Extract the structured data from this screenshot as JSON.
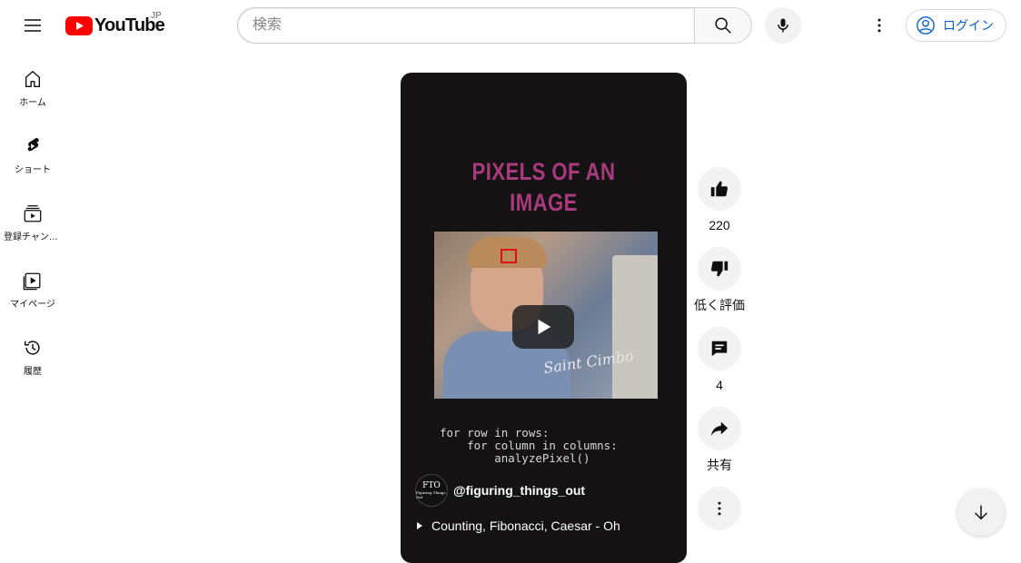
{
  "header": {
    "logo_text": "YouTube",
    "region": "JP",
    "search_placeholder": "検索",
    "login_label": "ログイン"
  },
  "sidebar": {
    "items": [
      {
        "label": "ホーム",
        "icon": "home-icon"
      },
      {
        "label": "ショート",
        "icon": "shorts-icon"
      },
      {
        "label": "登録チャンネル",
        "icon": "subscriptions-icon"
      },
      {
        "label": "マイページ",
        "icon": "library-icon"
      },
      {
        "label": "履歴",
        "icon": "history-icon"
      }
    ]
  },
  "short": {
    "frame_title": "PIXELS OF AN\nIMAGE",
    "code": "for row in rows:\n    for column in columns:\n        analyzePixel()",
    "signature": "Saint Cimbo",
    "channel_avatar_text": "FTO",
    "channel_avatar_subtext": "Figuring Things Out",
    "channel_handle": "@figuring_things_out",
    "playlist_title": "Counting, Fibonacci, Caesar - Oh"
  },
  "actions": {
    "like_count": "220",
    "dislike_label": "低く評価",
    "comment_count": "4",
    "share_label": "共有"
  },
  "colors": {
    "brand_red": "#ff0000",
    "link_blue": "#065fd4",
    "title_magenta": "#a83a7d"
  }
}
